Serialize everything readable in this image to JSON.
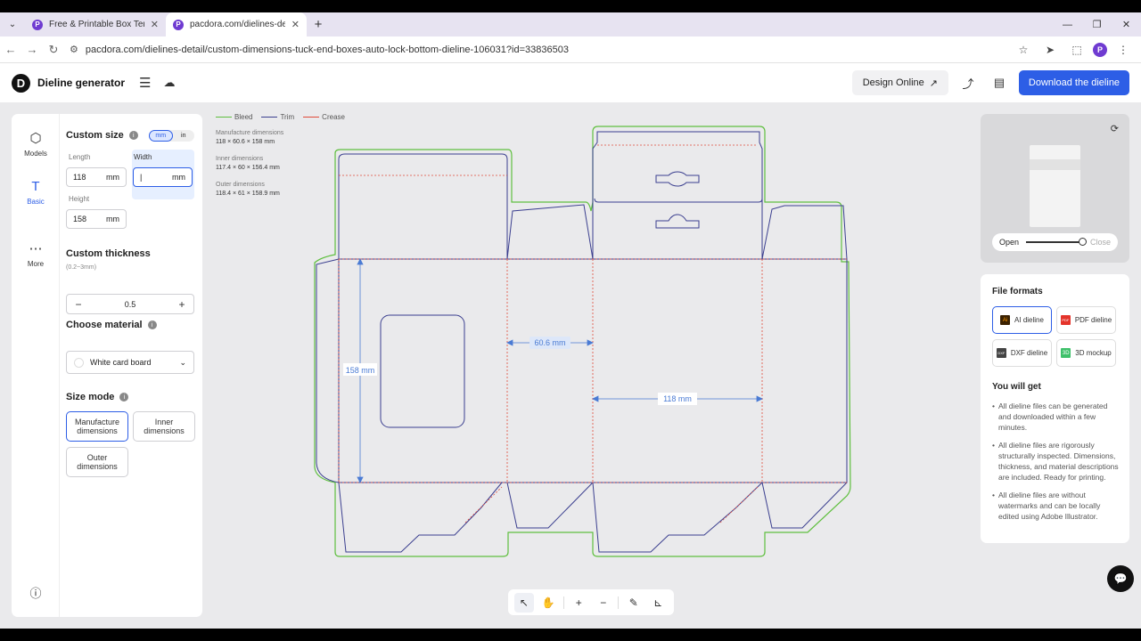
{
  "browser": {
    "tabs": [
      {
        "title": "Free & Printable Box Templat",
        "active": false
      },
      {
        "title": "pacdora.com/dielines-detail/",
        "active": true
      }
    ],
    "url": "pacdora.com/dielines-detail/custom-dimensions-tuck-end-boxes-auto-lock-bottom-dieline-106031?id=33836503",
    "profile_initial": "P"
  },
  "header": {
    "app_title": "Dieline generator",
    "design_online": "Design Online",
    "download": "Download the dieline"
  },
  "rail": {
    "models": "Models",
    "basic": "Basic",
    "more": "More"
  },
  "form": {
    "custom_size": "Custom size",
    "unit_mm": "mm",
    "unit_in": "in",
    "length_label": "Length",
    "length_value": "118",
    "width_label": "Width",
    "width_value": "",
    "height_label": "Height",
    "height_value": "158",
    "unit": "mm",
    "thickness_title": "Custom thickness",
    "thickness_hint": "(0.2~3mm)",
    "thickness_value": "0.5",
    "material_title": "Choose material",
    "material_value": "White card board",
    "size_mode_title": "Size mode",
    "modes": [
      "Manufacture dimensions",
      "Inner dimensions",
      "Outer dimensions"
    ],
    "selected_mode": "Manufacture dimensions"
  },
  "canvas": {
    "legend": [
      {
        "label": "Bleed",
        "color": "#5fbf3f"
      },
      {
        "label": "Trim",
        "color": "#3b3f8f"
      },
      {
        "label": "Crease",
        "color": "#e04a3a"
      }
    ],
    "dims": [
      {
        "label": "Manufacture dimensions",
        "value": "118 × 60.6 × 158 mm"
      },
      {
        "label": "Inner dimensions",
        "value": "117.4 × 60 × 156.4 mm"
      },
      {
        "label": "Outer dimensions",
        "value": "118.4 × 61 × 158.9 mm"
      }
    ],
    "dim_height": "158 mm",
    "dim_depth": "60.6 mm",
    "dim_width": "118 mm"
  },
  "preview": {
    "open": "Open",
    "close": "Close",
    "open_level": 1.0
  },
  "formats": {
    "title": "File formats",
    "items": [
      {
        "label": "AI dieline",
        "icon": "Ai",
        "color": "#3b2100"
      },
      {
        "label": "PDF dieline",
        "icon": "PDF",
        "color": "#e4342b"
      },
      {
        "label": "DXF dieline",
        "icon": "DXF",
        "color": "#444444"
      },
      {
        "label": "3D mockup",
        "icon": "3D",
        "color": "#3ec06a"
      }
    ],
    "you_will_get": "You will get",
    "bullets": [
      "All dieline files can be generated and downloaded within a few minutes.",
      "All dieline files are rigorously structurally inspected. Dimensions, thickness, and material descriptions are included. Ready for printing.",
      "All dieline files are without watermarks and can be locally edited using Adobe Illustrator."
    ]
  }
}
